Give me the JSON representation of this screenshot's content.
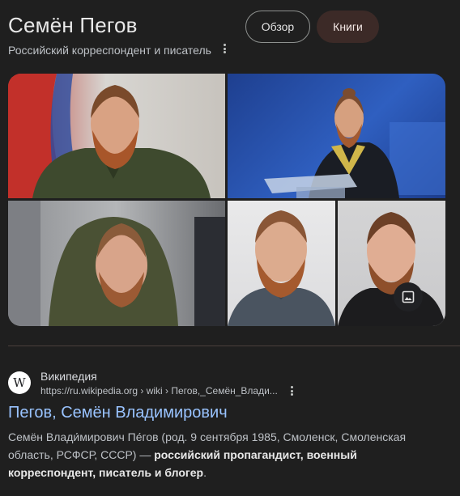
{
  "header": {
    "title": "Семён Пегов",
    "subtitle": "Российский корреспондент и писатель",
    "chips": [
      "Обзор",
      "Книги"
    ]
  },
  "gallery": {
    "images": [
      "portrait-flag-background",
      "speaker-at-podium",
      "man-in-hooded-jacket-outdoors",
      "portrait-light-background",
      "portrait-gray-background"
    ],
    "image_button_icon": "image-icon"
  },
  "result": {
    "source_name": "Википедия",
    "favicon_letter": "W",
    "url": "https://ru.wikipedia.org › wiki › Пегов,_Семён_Влади...",
    "title": "Пегов, Семён Владимирович",
    "snippet_plain_1": "Семён Влади́мирович Пе́гов (род. 9 сентября 1985, Смоленск, Смоленская область, РСФСР, СССР) — ",
    "snippet_bold": "российский пропагандист, военный корреспондент, писатель и блогер",
    "snippet_plain_2": "."
  },
  "colors": {
    "background": "#1f1f1f",
    "link": "#99c3ff",
    "chip_active_bg": "#3c2a27"
  }
}
